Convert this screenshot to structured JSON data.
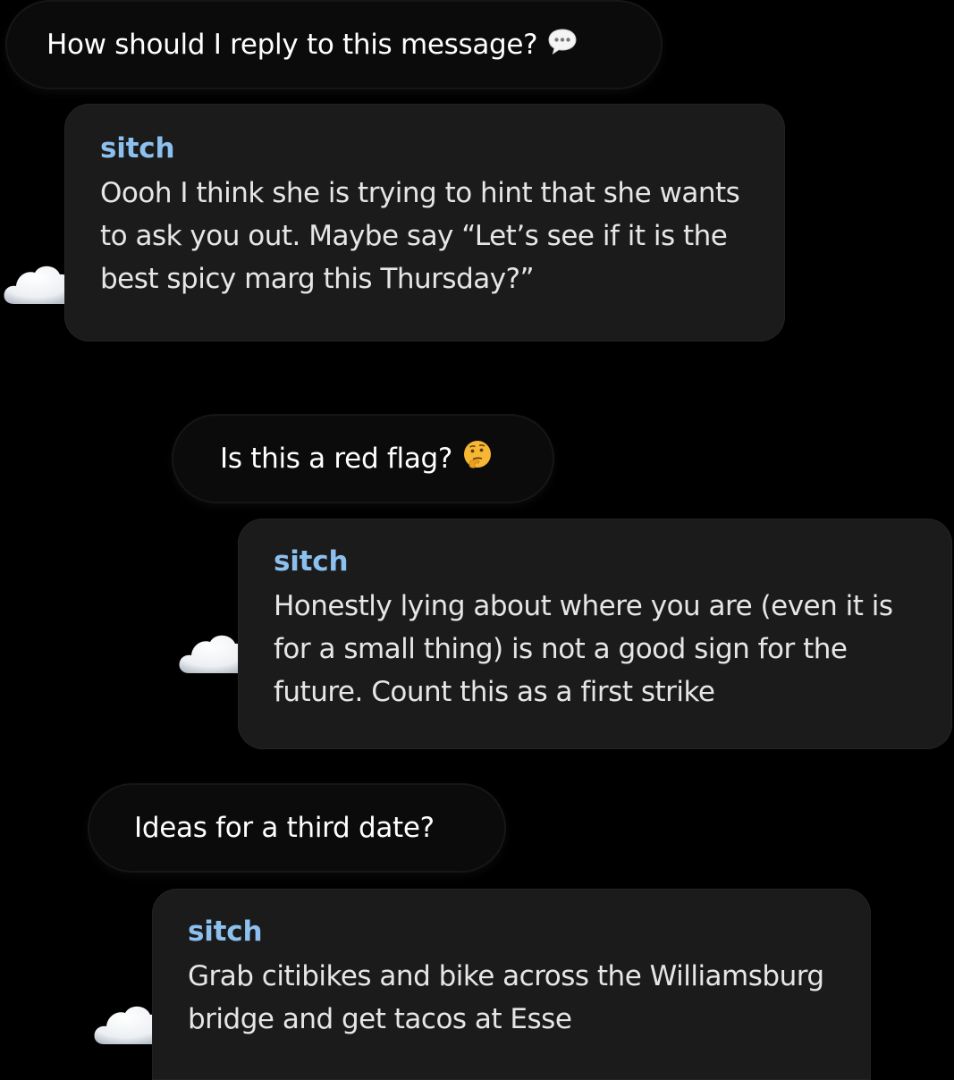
{
  "conversation": [
    {
      "role": "user",
      "text": "How should I reply to this message?",
      "emoji": "speech-bubble-icon"
    },
    {
      "role": "assistant",
      "sender": "sitch",
      "avatar": "cloud-icon",
      "text": "Oooh I think she is trying to hint that she wants to ask you out. Maybe say “Let’s see if it is the best spicy marg this Thursday?”"
    },
    {
      "role": "user",
      "text": "Is this a red flag?",
      "emoji": "thinking-face-icon"
    },
    {
      "role": "assistant",
      "sender": "sitch",
      "avatar": "cloud-icon",
      "text": "Honestly lying about where you are (even it is for a small thing) is not a good sign for the future. Count this as a first strike"
    },
    {
      "role": "user",
      "text": "Ideas for a third date?",
      "emoji": ""
    },
    {
      "role": "assistant",
      "sender": "sitch",
      "avatar": "cloud-icon",
      "text": "Grab citibikes and bike across the Williamsburg bridge and get tacos at Esse"
    }
  ],
  "colors": {
    "background": "#000000",
    "user_bubble": "#0b0b0b",
    "reply_card": "#1b1b1b",
    "sender_name": "#8cc0ee",
    "text": "#e6e6e6"
  }
}
